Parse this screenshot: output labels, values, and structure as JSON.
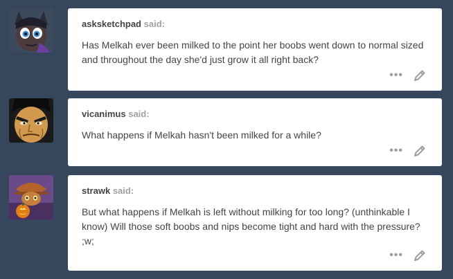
{
  "posts": [
    {
      "user": "asksketchpad",
      "said_label": "said:",
      "question": "Has Melkah ever been milked to the point her boobs went down to normal sized and throughout the day she'd just grow it all right back?",
      "more_label": "•••",
      "edit_icon": "pencil-icon"
    },
    {
      "user": "vicanimus",
      "said_label": "said:",
      "question": "What happens if Melkah hasn't been milked for a while?",
      "more_label": "•••",
      "edit_icon": "pencil-icon"
    },
    {
      "user": "strawk",
      "said_label": "said:",
      "question": "But what happens if Melkah is left without milking for too long? (unthinkable I know) Will those soft boobs and nips become tight and hard with the pressure? ;w;",
      "more_label": "•••",
      "edit_icon": "pencil-icon"
    }
  ],
  "colors": {
    "background": "#36465d",
    "card": "#ffffff",
    "text": "#444444",
    "muted": "#a0a0a0"
  }
}
